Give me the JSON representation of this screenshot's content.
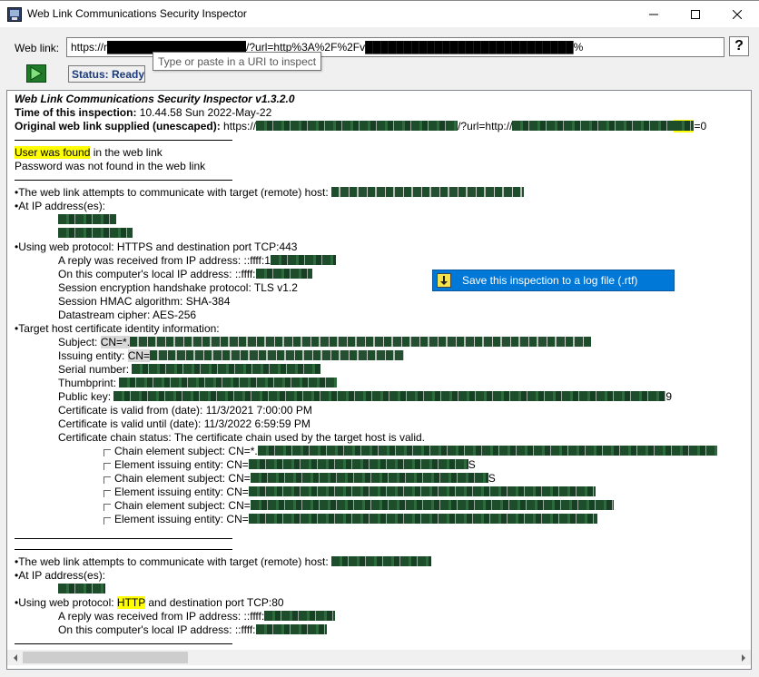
{
  "window": {
    "title": "Web Link Communications Security Inspector",
    "minimize_icon": "minimize-icon",
    "maximize_icon": "maximize-icon",
    "close_icon": "close-icon"
  },
  "toolbar": {
    "weblink_label": "Web link:",
    "url_value": "https://r██████████████████/?url=http%3A%2F%2Fv███████████████████████████%",
    "help_label": "?",
    "status_text": "Status: Ready",
    "tooltip_text": "Type or paste in a URI to inspect"
  },
  "report": {
    "heading": "Web Link Communications Security Inspector v1.3.2.0",
    "time_label": "Time of this inspection:",
    "time_value": " 10.44.58 Sun 2022-May-22",
    "original_label": "Original web link supplied (unescaped):",
    "original_prefix": " https://",
    "original_middle": "/?url=http://",
    "original_suffix": "=0",
    "user_found": "User was found",
    "user_found_rest": " in the web link",
    "password_line": "Password was not found in the web link",
    "target1_line": "•The web link attempts to communicate with target (remote) host: ",
    "ip_line": "•At IP address(es):",
    "protocol1": "•Using web protocol: HTTPS and destination port TCP:443",
    "reply1": "A reply was received from IP address: ::ffff:1",
    "local1": "On this computer's local IP address: ::ffff:",
    "handshake": "Session encryption handshake protocol: TLS v1.2",
    "hmac": "Session HMAC algorithm: SHA-384",
    "cipher": "Datastream cipher: AES-256",
    "cert_info": "•Target host certificate identity information:",
    "subject_label": "Subject: ",
    "subject_prefix": "CN=*.",
    "issuing_label": "Issuing entity: ",
    "issuing_prefix": "CN=",
    "serial_label": "Serial number: ",
    "thumb_label": "Thumbprint: ",
    "pubkey_label": "Public key: ",
    "pubkey_suffix": "9",
    "valid_from": "Certificate is valid from (date): 11/3/2021 7:00:00 PM",
    "valid_until": "Certificate is valid until (date): 11/3/2022 6:59:59 PM",
    "chain_status": "Certificate chain status: The certificate chain used by the target host is valid.",
    "chain": [
      {
        "label": "Chain element subject: ",
        "prefix": "CN=*.",
        "suffix": ""
      },
      {
        "label": "Element issuing entity: ",
        "prefix": "CN=",
        "suffix": "S"
      },
      {
        "label": "Chain element subject: ",
        "prefix": "CN=",
        "suffix": "S"
      },
      {
        "label": "Element issuing entity: ",
        "prefix": "CN=",
        "suffix": ""
      },
      {
        "label": "Chain element subject: ",
        "prefix": "CN=",
        "suffix": ""
      },
      {
        "label": "Element issuing entity: ",
        "prefix": "CN=",
        "suffix": ""
      }
    ],
    "target2_line": "•The web link attempts to communicate with target (remote) host: ",
    "ip_line2": "•At IP address(es):",
    "protocol2_prefix": "•Using web protocol: ",
    "protocol2_http": "HTTP",
    "protocol2_suffix": " and destination port TCP:80",
    "reply2": "A reply was received from IP address: ::ffff:",
    "local2": "On this computer's local IP address: ::ffff:"
  },
  "context_menu": {
    "item_label": "Save this inspection to a log file (.rtf)",
    "item_icon": "save-log-icon"
  },
  "colors": {
    "highlight": "#ffff00",
    "menu_selected": "#0078d7",
    "status_text": "#1a3a7a",
    "redaction": "#1d4d2b"
  }
}
